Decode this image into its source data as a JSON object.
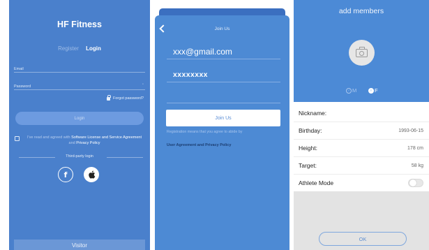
{
  "login": {
    "title": "HF Fitness",
    "tab_register": "Register",
    "tab_login": "Login",
    "email_label": "Email",
    "password_label": "Password",
    "forgot_password": "Forgot password?",
    "login_button": "Login",
    "agreement_prefix": "I've read and agreed with ",
    "agreement_link1": "Software License and Service Agreement",
    "agreement_and": " and ",
    "agreement_link2": "Privacy Policy",
    "third_party": "Third-party login",
    "visitor_button": "Visitor"
  },
  "join": {
    "header": "Join Us",
    "email_value": "xxx@gmail.com",
    "password_value": "xxxxxxxx",
    "join_button": "Join Us",
    "note": "Registration means that you agree to abide by",
    "terms": "User Agreement and Privacy Policy"
  },
  "members": {
    "title": "add members",
    "gender_male": "M",
    "gender_female": "F",
    "rows": [
      {
        "label": "Nickname:",
        "value": ""
      },
      {
        "label": "Birthday:",
        "value": "1993-06-15"
      },
      {
        "label": "Height:",
        "value": "178 cm"
      },
      {
        "label": "Target:",
        "value": "58 kg"
      },
      {
        "label": "Athlete Mode",
        "value": ""
      }
    ],
    "athlete_mode_on": false,
    "ok_button": "OK"
  },
  "colors": {
    "primary_blue": "#4a80cc",
    "join_blue": "#4d8ad4",
    "members_blue": "#4c8ad6"
  }
}
